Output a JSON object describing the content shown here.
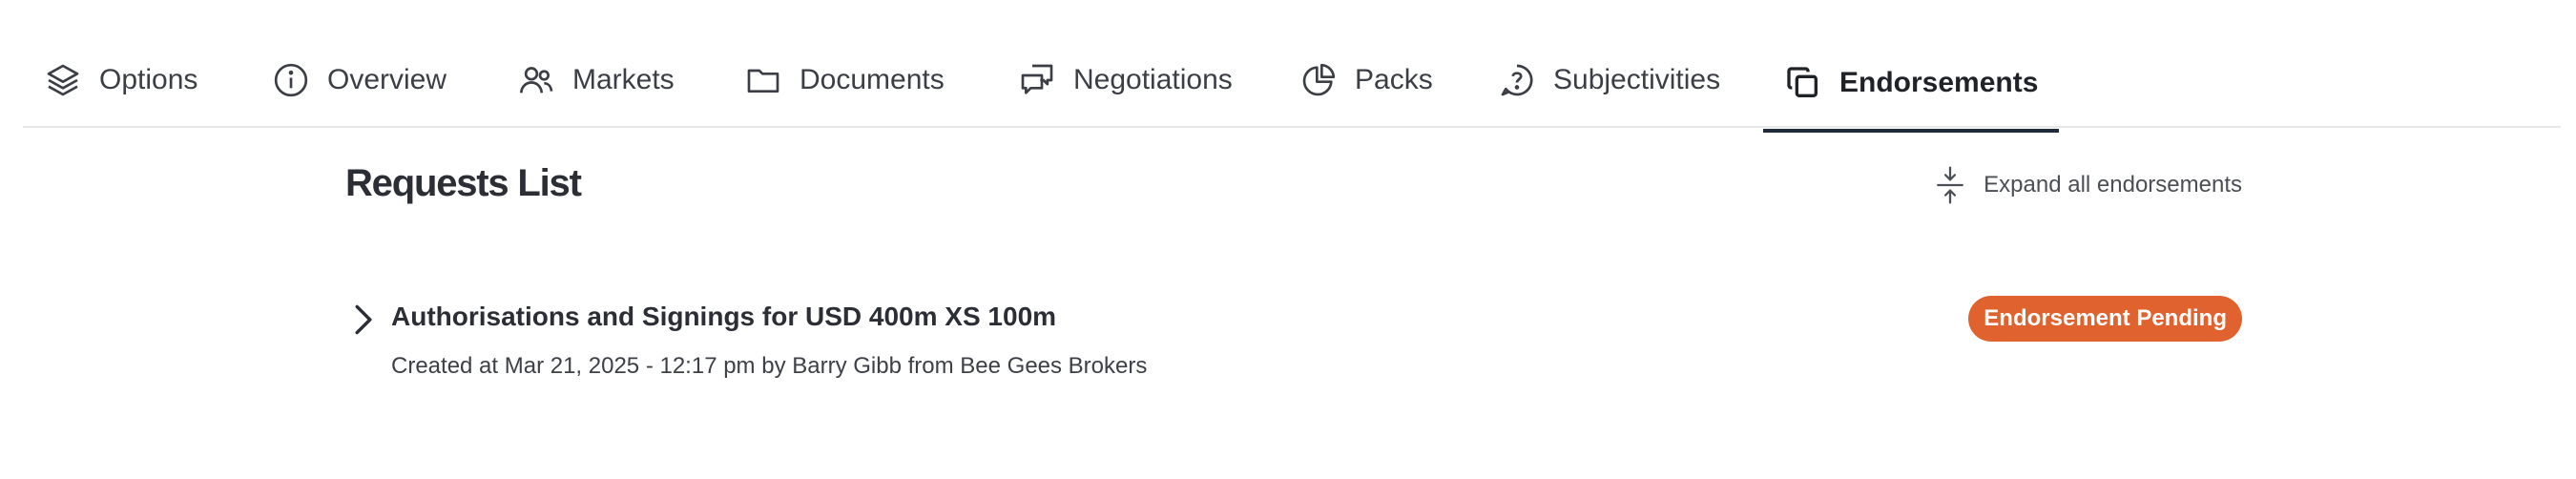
{
  "tabs": [
    {
      "label": "Options",
      "icon": "layers-icon"
    },
    {
      "label": "Overview",
      "icon": "info-icon"
    },
    {
      "label": "Markets",
      "icon": "users-icon"
    },
    {
      "label": "Documents",
      "icon": "folder-icon"
    },
    {
      "label": "Negotiations",
      "icon": "chat-bubbles-icon"
    },
    {
      "label": "Packs",
      "icon": "pie-chart-icon"
    },
    {
      "label": "Subjectivities",
      "icon": "question-bubble-icon"
    },
    {
      "label": "Endorsements",
      "icon": "copy-icon",
      "active": true
    }
  ],
  "page": {
    "title": "Requests List",
    "expand_label": "Expand all endorsements"
  },
  "requests": [
    {
      "title": "Authorisations and Signings for USD 400m XS 100m",
      "meta": "Created at Mar 21, 2025 - 12:17 pm by Barry Gibb from Bee Gees Brokers",
      "status": "Endorsement Pending",
      "status_color": "#e0622f"
    }
  ],
  "colors": {
    "active_tab_underline": "#1f2a3a",
    "text": "#2f3237"
  }
}
